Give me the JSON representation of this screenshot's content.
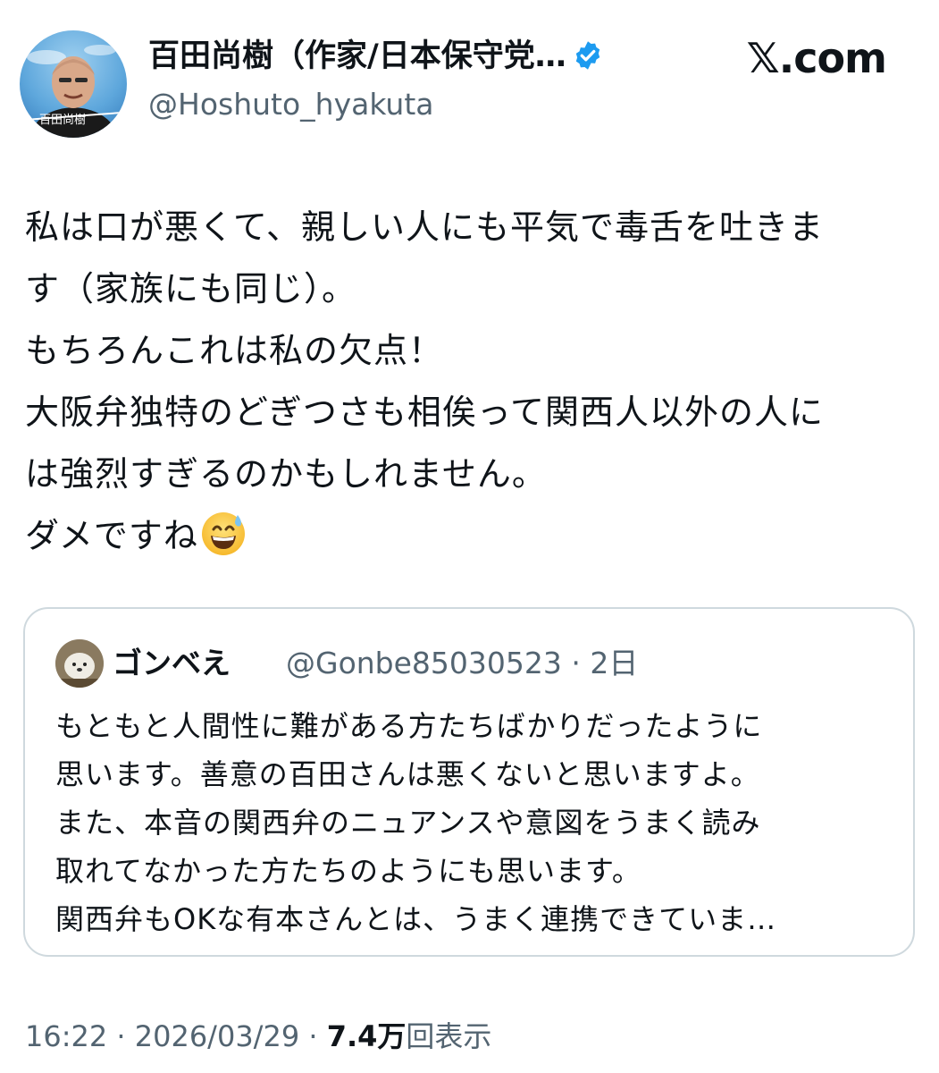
{
  "author": {
    "display_name": "百田尚樹（作家/日本保守党…",
    "handle": "@Hoshuto_hyakuta",
    "avatar_caption": "百田尚樹",
    "verified_color": "#1d9bf0"
  },
  "brand": {
    "label": "𝕏.com"
  },
  "tweet": {
    "lines": [
      "私は口が悪くて、親しい人にも平気で毒舌を吐きま",
      "す（家族にも同じ）。",
      "もちろんこれは私の欠点！",
      "大阪弁独特のどぎつさも相俟って関西人以外の人に",
      "は強烈すぎるのかもしれません。",
      "ダメですね"
    ],
    "emoji": "grinning-face-with-sweat"
  },
  "quote": {
    "name": "ゴンベえ",
    "handle_and_time": "@Gonbe85030523 · 2日",
    "lines": [
      "もともと人間性に難がある方たちばかりだったように",
      "思います。善意の百田さんは悪くないと思いますよ。",
      "また、本音の関西弁のニュアンスや意図をうまく読み",
      "取れてなかった方たちのようにも思います。",
      "関西弁もOKな有本さんとは、うまく連携できていま…"
    ]
  },
  "meta": {
    "timestamp": "16:22 · 2026/03/29 · ",
    "views_count": "7.4万",
    "views_label": "回表示"
  },
  "colors": {
    "text": "#0f1419",
    "secondary": "#536471",
    "border": "#cfd9de"
  }
}
